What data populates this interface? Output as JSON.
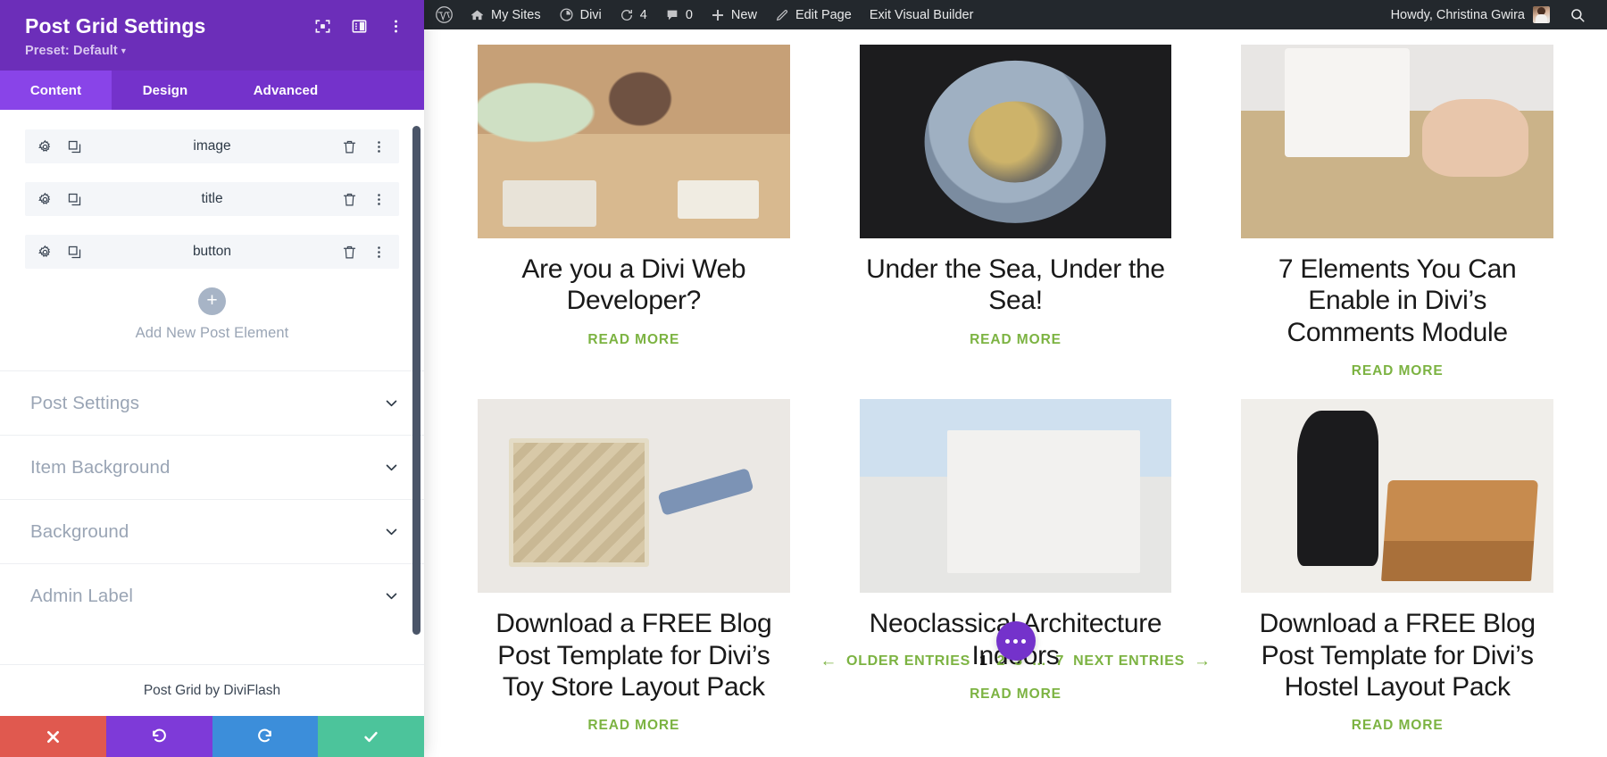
{
  "settings_panel": {
    "title": "Post Grid Settings",
    "preset_label": "Preset: Default",
    "header_icons": [
      {
        "name": "focus-target-icon"
      },
      {
        "name": "layout-panel-icon"
      },
      {
        "name": "more-options-icon"
      }
    ],
    "tabs": [
      {
        "label": "Content",
        "active": true
      },
      {
        "label": "Design",
        "active": false
      },
      {
        "label": "Advanced",
        "active": false
      }
    ],
    "elements": [
      {
        "label": "image"
      },
      {
        "label": "title"
      },
      {
        "label": "button"
      }
    ],
    "add_element_label": "Add New Post Element",
    "accordions": [
      {
        "label": "Post Settings"
      },
      {
        "label": "Item Background"
      },
      {
        "label": "Background"
      },
      {
        "label": "Admin Label"
      }
    ],
    "footer_label": "Post Grid by DiviFlash",
    "actions": [
      {
        "name": "cancel-button",
        "icon": "close-icon",
        "color": "#E0594F"
      },
      {
        "name": "undo-button",
        "icon": "undo-icon",
        "color": "#7E3AD8"
      },
      {
        "name": "redo-button",
        "icon": "redo-icon",
        "color": "#3C8EDA"
      },
      {
        "name": "save-button",
        "icon": "check-icon",
        "color": "#4CC49B"
      }
    ],
    "colors": {
      "header_bg": "#6C2EB9",
      "tab_bar_bg": "#7432CB",
      "tab_active_bg": "#8944E8",
      "row_bg": "#F4F6F9"
    }
  },
  "admin_bar": {
    "items": [
      {
        "label": "",
        "icon": "wordpress-logo-icon"
      },
      {
        "label": "My Sites",
        "icon": "sites-icon"
      },
      {
        "label": "Divi",
        "icon": "divi-icon"
      },
      {
        "label": "4",
        "icon": "updates-icon"
      },
      {
        "label": "0",
        "icon": "comments-icon"
      },
      {
        "label": "New",
        "icon": "plus-icon"
      },
      {
        "label": "Edit Page",
        "icon": "pencil-icon"
      },
      {
        "label": "Exit Visual Builder",
        "icon": ""
      }
    ],
    "howdy": "Howdy, Christina Gwira",
    "search_icon": "search-icon"
  },
  "post_grid": {
    "read_more_label": "READ MORE",
    "read_more_color": "#7CB342",
    "posts": [
      {
        "title": "Are you a Divi Web Developer?",
        "thumb": "t1"
      },
      {
        "title": "Under the Sea, Under the Sea!",
        "thumb": "t2"
      },
      {
        "title": "7 Elements You Can Enable in Divi’s Comments Module",
        "thumb": "t3"
      },
      {
        "title": "Download a FREE Blog Post Template for Divi’s Toy Store Layout Pack",
        "thumb": "t4"
      },
      {
        "title": "Neoclassical Architecture Indoors",
        "thumb": "t5"
      },
      {
        "title": "Download a FREE Blog Post Template for Divi’s Hostel Layout Pack",
        "thumb": "t6"
      }
    ]
  },
  "pagination": {
    "prev_arrow": "←",
    "prev_label": "OLDER ENTRIES",
    "pages": [
      "1",
      "2",
      "3"
    ],
    "ellipsis": "…",
    "last_page": "7",
    "current_page": "1",
    "next_label": "NEXT ENTRIES",
    "next_arrow": "→"
  },
  "fab": {
    "name": "divi-menu-fab",
    "color": "#7432CB"
  }
}
